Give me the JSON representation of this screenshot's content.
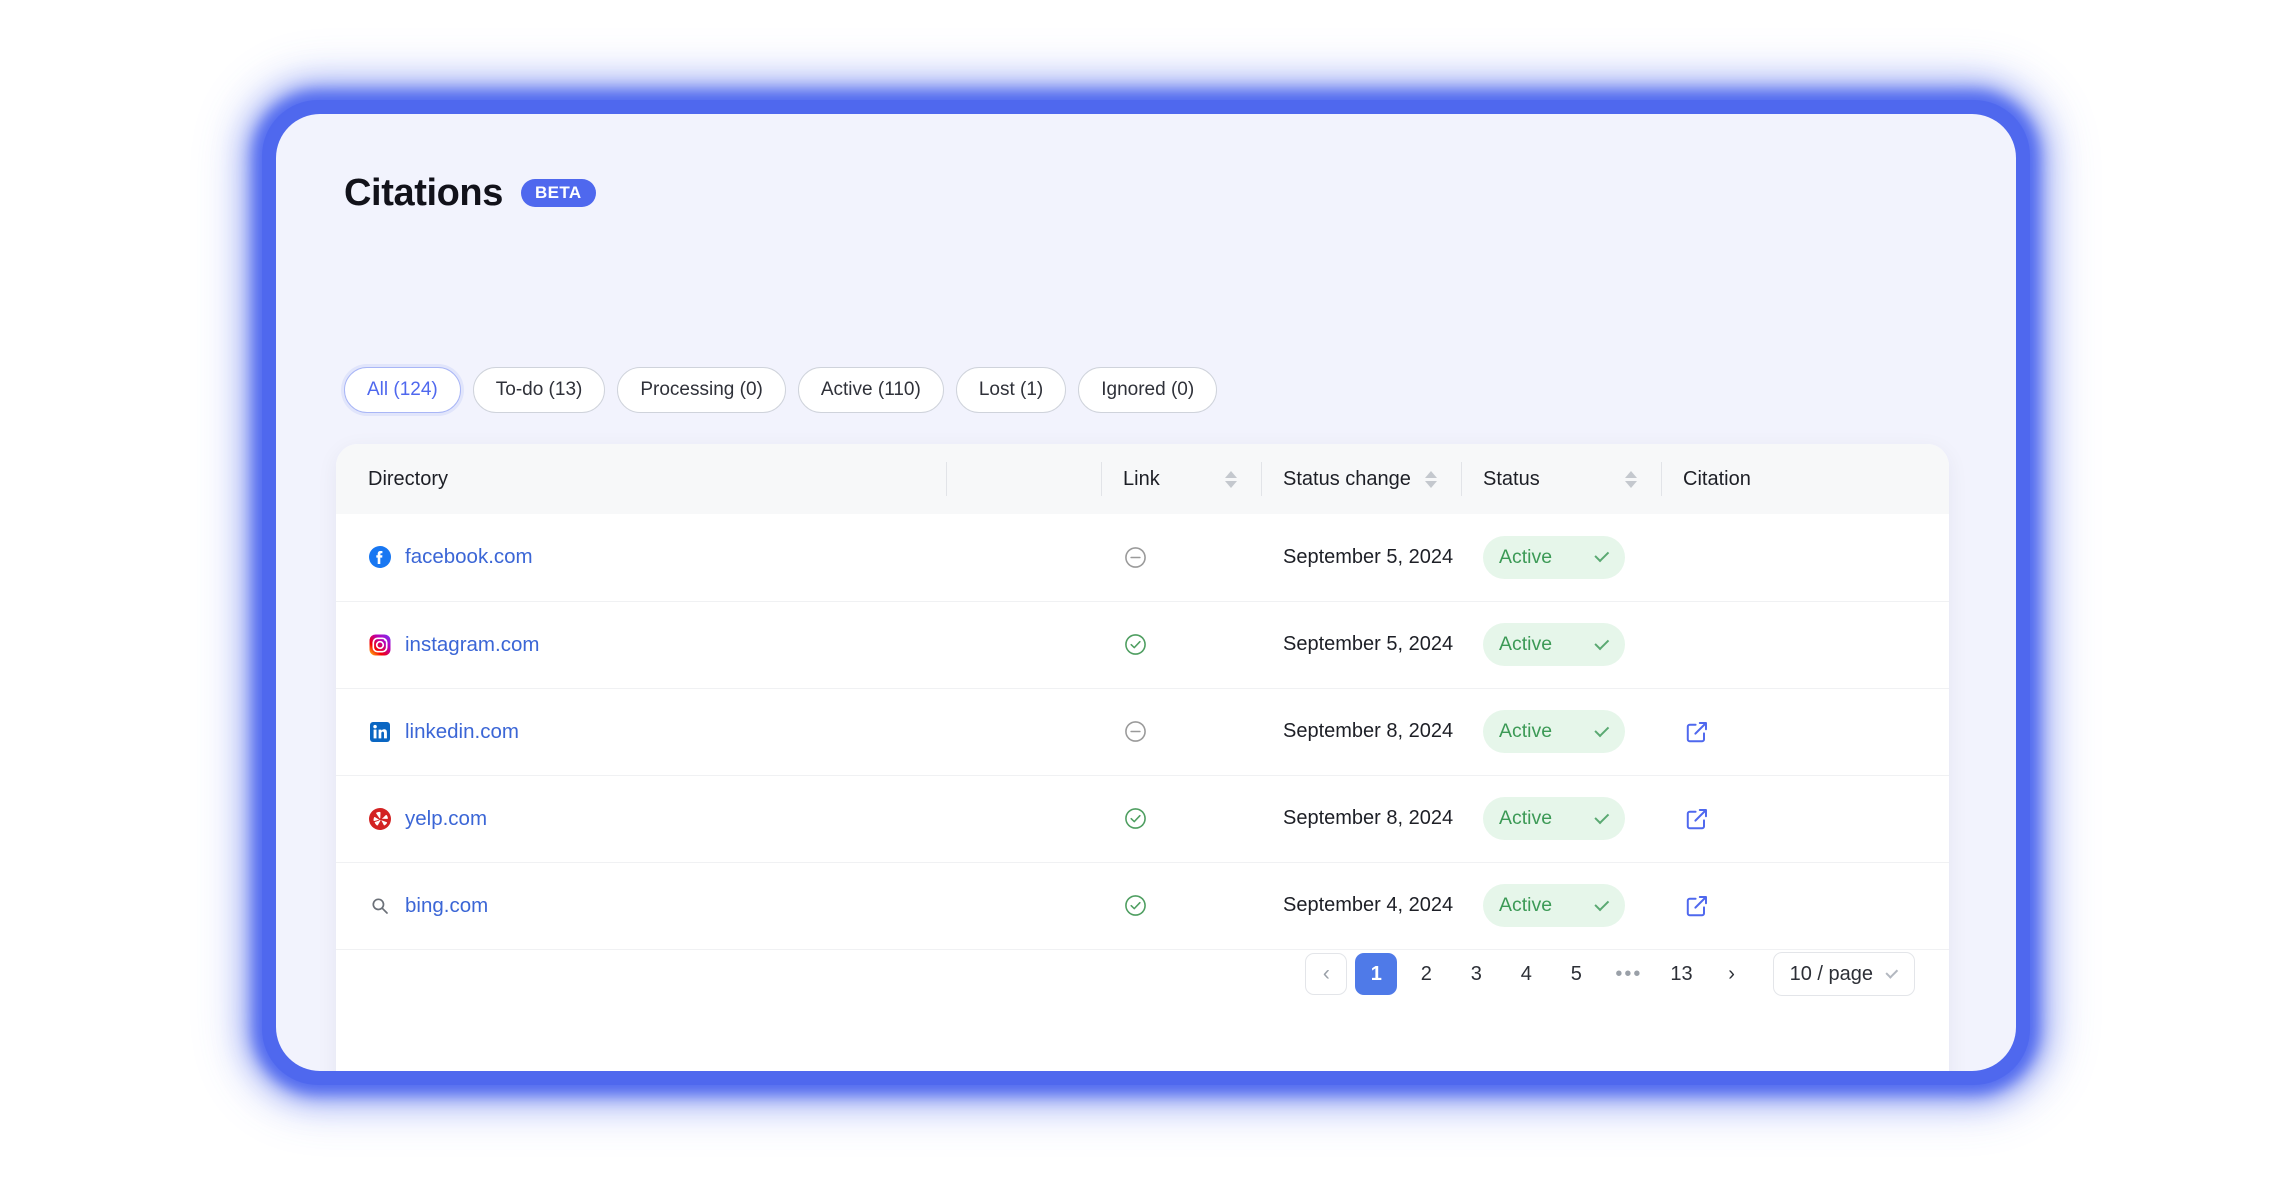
{
  "header": {
    "title": "Citations",
    "badge": "BETA"
  },
  "filters": [
    {
      "label": "All (124)",
      "active": true,
      "name": "filter-all"
    },
    {
      "label": "To-do (13)",
      "active": false,
      "name": "filter-todo"
    },
    {
      "label": "Processing (0)",
      "active": false,
      "name": "filter-processing"
    },
    {
      "label": "Active (110)",
      "active": false,
      "name": "filter-active"
    },
    {
      "label": "Lost (1)",
      "active": false,
      "name": "filter-lost"
    },
    {
      "label": "Ignored (0)",
      "active": false,
      "name": "filter-ignored"
    }
  ],
  "table": {
    "columns": {
      "directory": "Directory",
      "link": "Link",
      "status_change": "Status change",
      "status": "Status",
      "citation": "Citation"
    },
    "rows": [
      {
        "directory": "facebook.com",
        "icon": "facebook-icon",
        "link_state": "disabled",
        "link_icon": "minus-circle-icon",
        "status_change": "September 5, 2024",
        "status": "Active",
        "citation_icon": null
      },
      {
        "directory": "instagram.com",
        "icon": "instagram-icon",
        "link_state": "ok",
        "link_icon": "check-circle-icon",
        "status_change": "September 5, 2024",
        "status": "Active",
        "citation_icon": null
      },
      {
        "directory": "linkedin.com",
        "icon": "linkedin-icon",
        "link_state": "disabled",
        "link_icon": "minus-circle-icon",
        "status_change": "September 8, 2024",
        "status": "Active",
        "citation_icon": "external-link-icon"
      },
      {
        "directory": "yelp.com",
        "icon": "yelp-icon",
        "link_state": "ok",
        "link_icon": "check-circle-icon",
        "status_change": "September 8, 2024",
        "status": "Active",
        "citation_icon": "external-link-icon"
      },
      {
        "directory": "bing.com",
        "icon": "bing-search-icon",
        "link_state": "ok",
        "link_icon": "check-circle-icon",
        "status_change": "September 4, 2024",
        "status": "Active",
        "citation_icon": "external-link-icon"
      }
    ]
  },
  "pagination": {
    "prev": "‹",
    "next": "›",
    "pages": [
      "1",
      "2",
      "3",
      "4",
      "5",
      "•••",
      "13"
    ],
    "current": "1",
    "page_size": "10 / page"
  },
  "colors": {
    "accent": "#4f68ee",
    "pager_active": "#4f7ae8",
    "link_text": "#3b66d6",
    "status_green": "#3c9a56",
    "status_bg": "#e6f6ea",
    "panel_bg": "#f2f3fd"
  }
}
